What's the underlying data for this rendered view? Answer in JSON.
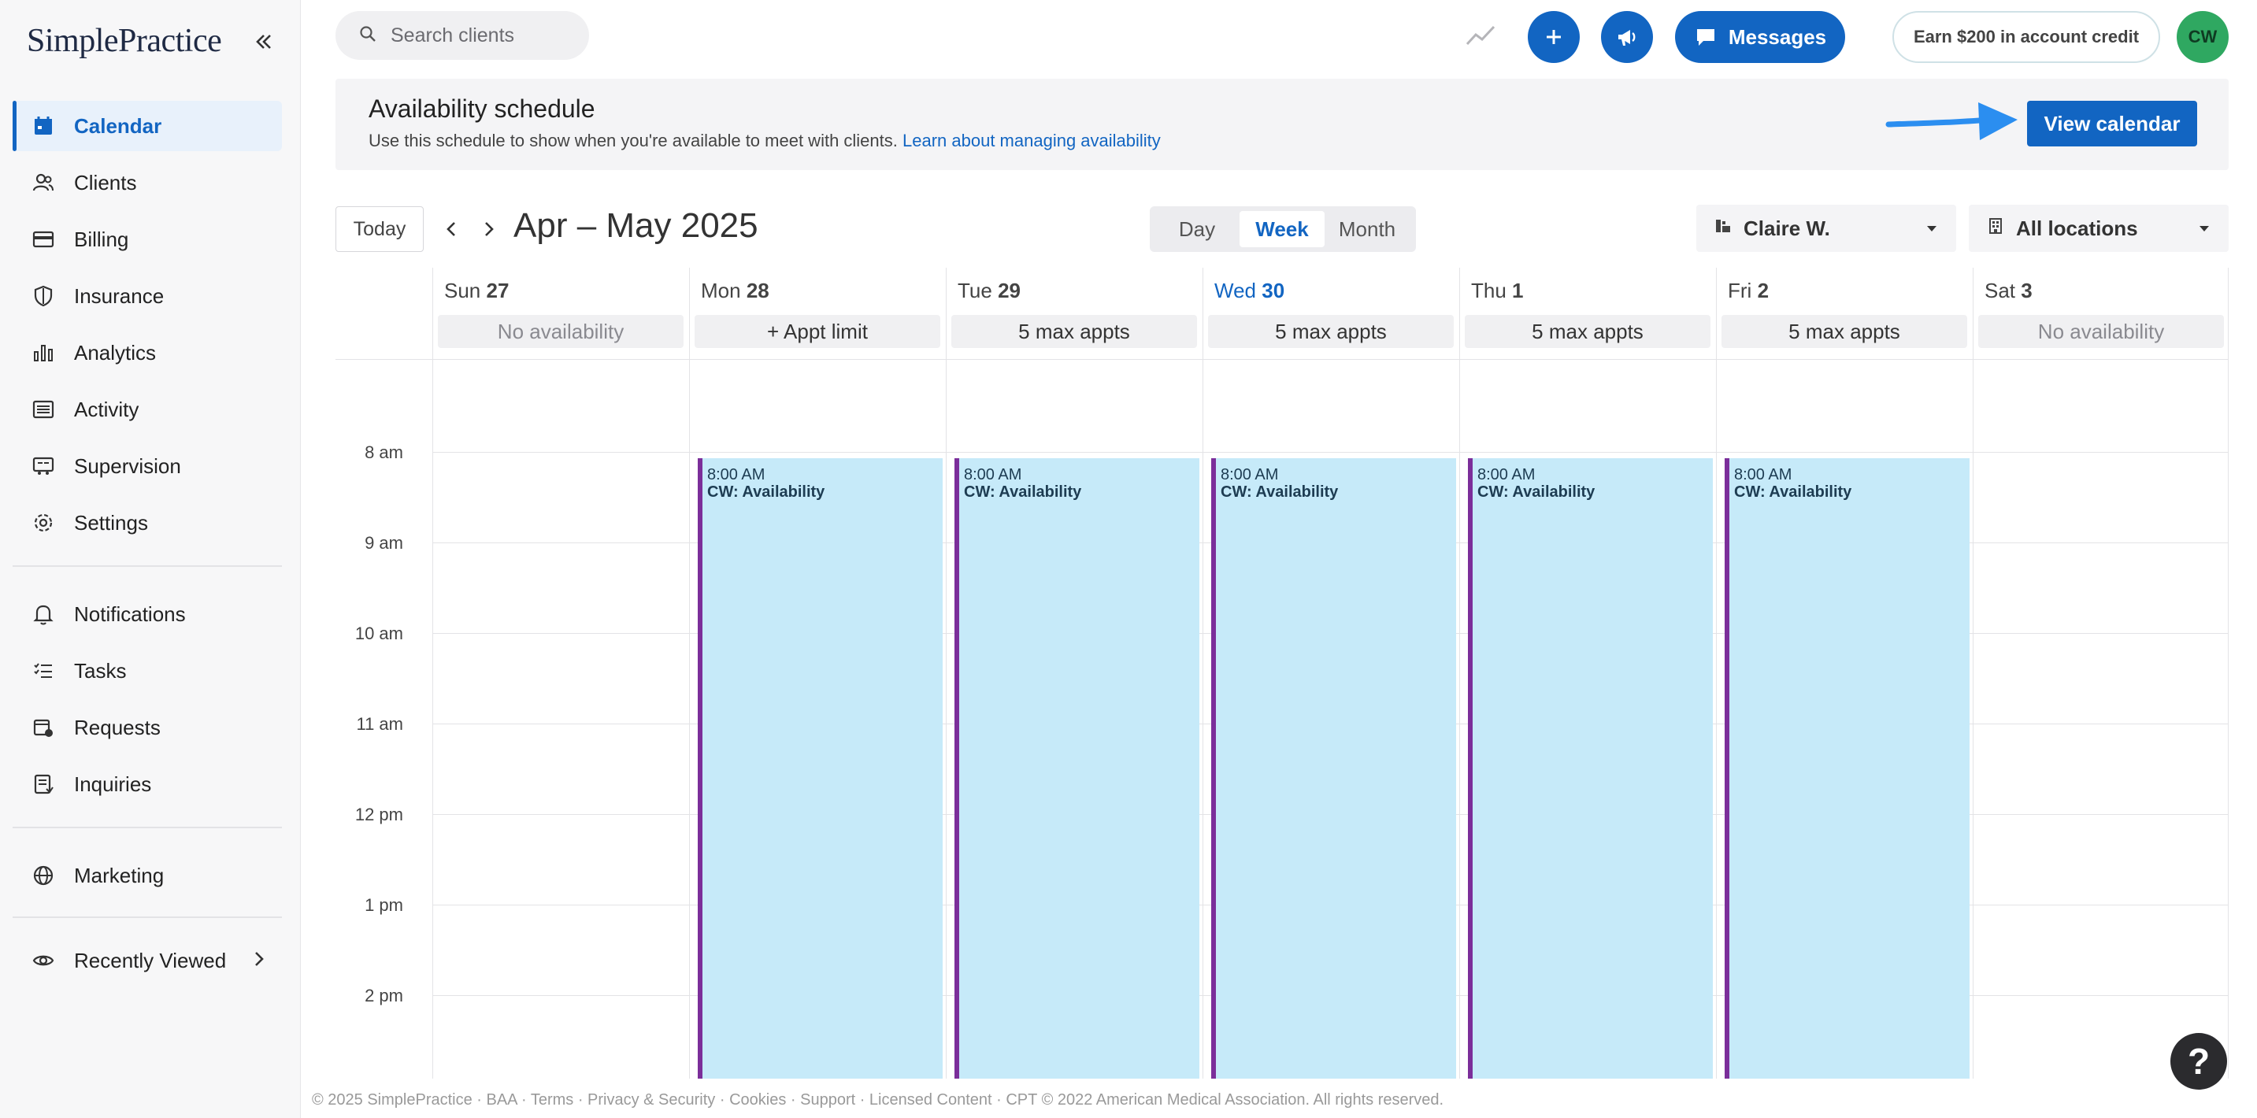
{
  "brand": {
    "logo_text": "SimplePractice"
  },
  "sidebar": {
    "items": [
      {
        "label": "Calendar",
        "icon": "calendar-icon",
        "active": true
      },
      {
        "label": "Clients",
        "icon": "users-icon"
      },
      {
        "label": "Billing",
        "icon": "credit-card-icon"
      },
      {
        "label": "Insurance",
        "icon": "shield-icon"
      },
      {
        "label": "Analytics",
        "icon": "bar-chart-icon"
      },
      {
        "label": "Activity",
        "icon": "list-icon"
      },
      {
        "label": "Supervision",
        "icon": "supervision-icon"
      },
      {
        "label": "Settings",
        "icon": "gear-icon"
      },
      {
        "label": "Notifications",
        "icon": "bell-icon"
      },
      {
        "label": "Tasks",
        "icon": "checklist-icon"
      },
      {
        "label": "Requests",
        "icon": "calendar-request-icon"
      },
      {
        "label": "Inquiries",
        "icon": "inquiry-icon"
      },
      {
        "label": "Marketing",
        "icon": "globe-icon"
      },
      {
        "label": "Recently Viewed",
        "icon": "eye-icon"
      }
    ]
  },
  "topbar": {
    "search_placeholder": "Search clients",
    "messages_label": "Messages",
    "credit_label": "Earn $200 in account credit",
    "avatar_initials": "CW"
  },
  "banner": {
    "title": "Availability schedule",
    "description": "Use this schedule to show when you're available to meet with clients.",
    "link_text": "Learn about managing availability",
    "view_calendar_label": "View calendar"
  },
  "controls": {
    "today_label": "Today",
    "date_range": "Apr – May 2025",
    "views": [
      "Day",
      "Week",
      "Month"
    ],
    "active_view": "Week",
    "clinician": "Claire W.",
    "location": "All locations"
  },
  "days": [
    {
      "dow": "Sun",
      "date": "27",
      "availability": "No availability"
    },
    {
      "dow": "Mon",
      "date": "28",
      "availability": "+ Appt limit"
    },
    {
      "dow": "Tue",
      "date": "29",
      "availability": "5 max appts"
    },
    {
      "dow": "Wed",
      "date": "30",
      "availability": "5 max appts",
      "today": true
    },
    {
      "dow": "Thu",
      "date": "1",
      "availability": "5 max appts"
    },
    {
      "dow": "Fri",
      "date": "2",
      "availability": "5 max appts"
    },
    {
      "dow": "Sat",
      "date": "3",
      "availability": "No availability"
    }
  ],
  "time_labels": [
    "8 am",
    "9 am",
    "10 am",
    "11 am",
    "12 pm",
    "1 pm",
    "2 pm"
  ],
  "events": [
    {
      "time": "8:00 AM",
      "title": "CW: Availability"
    },
    {
      "time": "8:00 AM",
      "title": "CW: Availability"
    },
    {
      "time": "8:00 AM",
      "title": "CW: Availability"
    },
    {
      "time": "8:00 AM",
      "title": "CW: Availability"
    },
    {
      "time": "8:00 AM",
      "title": "CW: Availability"
    }
  ],
  "footer": {
    "text": "© 2025 SimplePractice · BAA · Terms · Privacy & Security · Cookies · Support · Licensed Content · CPT © 2022 American Medical Association. All rights reserved."
  },
  "colors": {
    "primary": "#1265c2",
    "event_fill": "#c6eaf9",
    "event_border": "#7b2e9a",
    "avatar": "#2fa861"
  }
}
